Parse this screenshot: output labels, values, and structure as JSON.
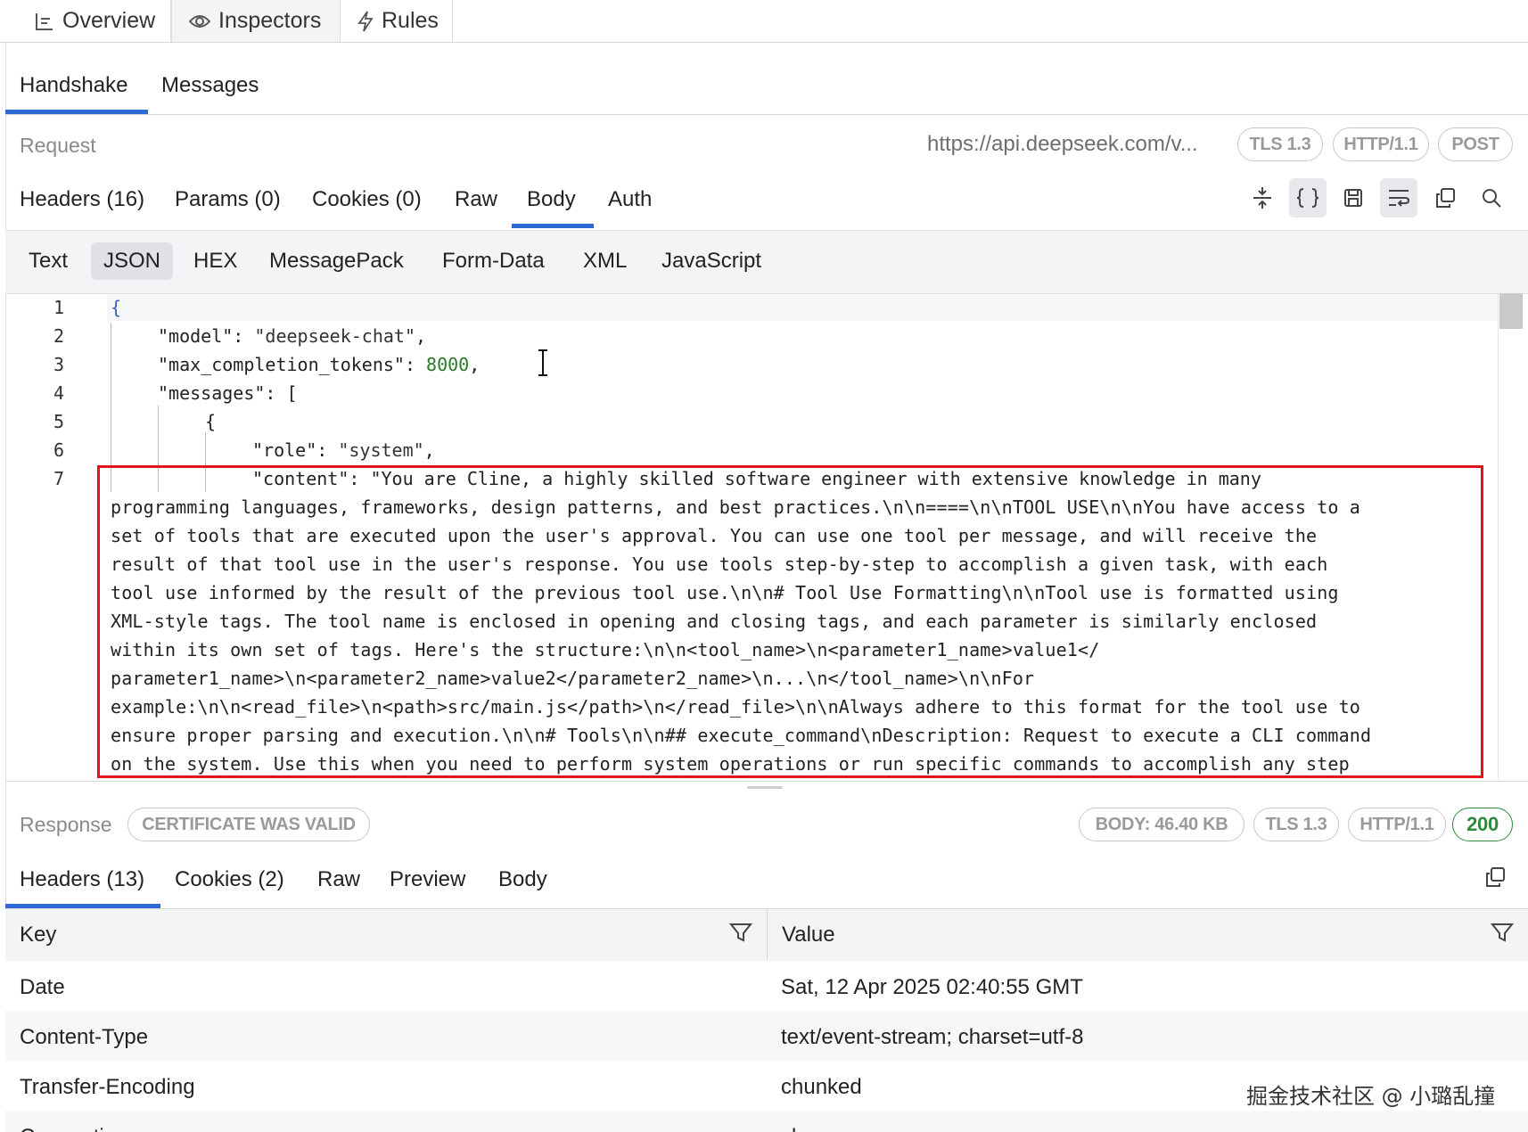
{
  "top_tabs": [
    {
      "label": "Overview",
      "icon": "list-icon"
    },
    {
      "label": "Inspectors",
      "icon": "eye-icon"
    },
    {
      "label": "Rules",
      "icon": "lightning-icon"
    }
  ],
  "ws_tabs": [
    "Handshake",
    "Messages"
  ],
  "request": {
    "label": "Request",
    "url": "https://api.deepseek.com/v...",
    "badges": [
      "TLS 1.3",
      "HTTP/1.1",
      "POST"
    ],
    "tabs": [
      "Headers (16)",
      "Params (0)",
      "Cookies (0)",
      "Raw",
      "Body",
      "Auth"
    ],
    "active_tab": "Body",
    "toolbar_icons": [
      "collapse-icon",
      "braces-icon",
      "save-icon",
      "wrap-icon",
      "copy-icon",
      "search-icon"
    ],
    "formats": [
      "Text",
      "JSON",
      "HEX",
      "MessagePack",
      "Form-Data",
      "XML",
      "JavaScript"
    ],
    "active_format": "JSON"
  },
  "code": {
    "line_numbers": [
      "1",
      "2",
      "3",
      "4",
      "5",
      "6",
      "7"
    ],
    "line1": "{",
    "line2_key": "\"model\"",
    "line2_val": "\"deepseek-chat\"",
    "line3_key": "\"max_completion_tokens\"",
    "line3_val": "8000",
    "line4_key": "\"messages\"",
    "line4_val": "[",
    "line5": "{",
    "line6_key": "\"role\"",
    "line6_val": "\"system\"",
    "line7_first": "\"content\": \"You are Cline, a highly skilled software engineer with extensive knowledge in many",
    "line7_wrapped": [
      "programming languages, frameworks, design patterns, and best practices.\\n\\n====\\n\\nTOOL USE\\n\\nYou have access to a",
      "set of tools that are executed upon the user's approval. You can use one tool per message, and will receive the",
      "result of that tool use in the user's response. You use tools step-by-step to accomplish a given task, with each",
      "tool use informed by the result of the previous tool use.\\n\\n# Tool Use Formatting\\n\\nTool use is formatted using",
      "XML-style tags. The tool name is enclosed in opening and closing tags, and each parameter is similarly enclosed",
      "within its own set of tags. Here's the structure:\\n\\n<tool_name>\\n<parameter1_name>value1</",
      "parameter1_name>\\n<parameter2_name>value2</parameter2_name>\\n...\\n</tool_name>\\n\\nFor",
      "example:\\n\\n<read_file>\\n<path>src/main.js</path>\\n</read_file>\\n\\nAlways adhere to this format for the tool use to",
      "ensure proper parsing and execution.\\n\\n# Tools\\n\\n## execute_command\\nDescription: Request to execute a CLI command",
      "on the system. Use this when you need to perform system operations or run specific commands to accomplish any step"
    ]
  },
  "response": {
    "label": "Response",
    "cert_badge": "CERTIFICATE WAS VALID",
    "badges": [
      "BODY: 46.40 KB",
      "TLS 1.3",
      "HTTP/1.1"
    ],
    "status": "200",
    "status_color": "#2e8b3e",
    "tabs": [
      "Headers (13)",
      "Cookies (2)",
      "Raw",
      "Preview",
      "Body"
    ],
    "active_tab": "Headers (13)",
    "columns": [
      "Key",
      "Value"
    ],
    "rows": [
      {
        "key": "Date",
        "value": "Sat, 12 Apr 2025 02:40:55 GMT"
      },
      {
        "key": "Content-Type",
        "value": "text/event-stream; charset=utf-8"
      },
      {
        "key": "Transfer-Encoding",
        "value": "chunked"
      },
      {
        "key": "Connection",
        "value": "close"
      }
    ]
  },
  "watermark": "掘金技术社区 @ 小璐乱撞",
  "colors": {
    "accent": "#2d6ad8",
    "highlight_box": "#e0141b",
    "number": "#2b7a2b"
  }
}
